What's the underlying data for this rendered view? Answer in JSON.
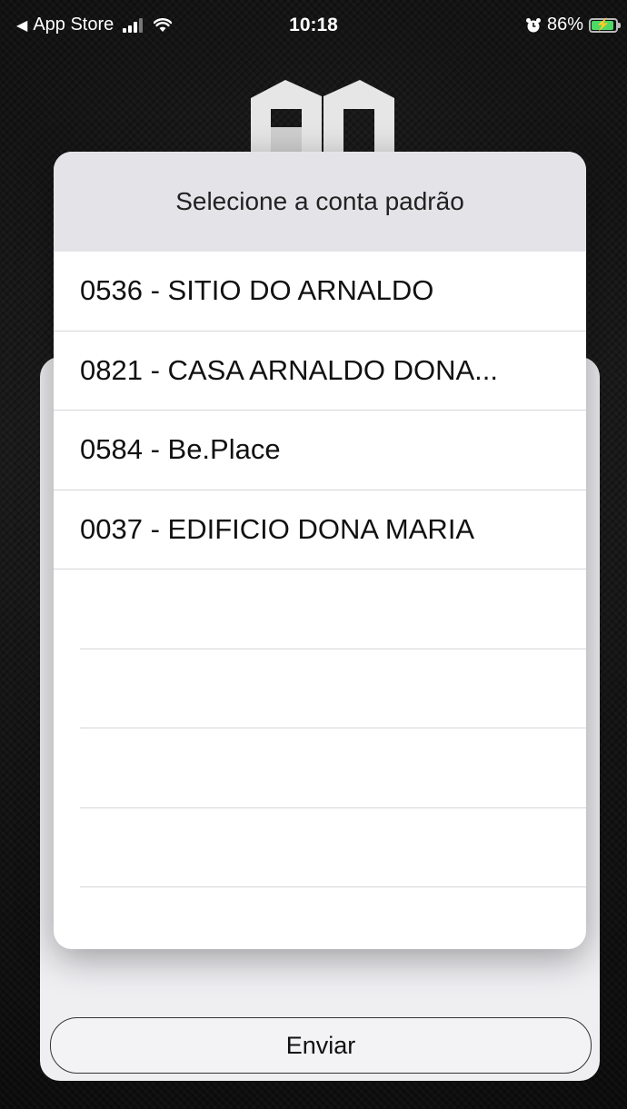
{
  "status_bar": {
    "back_label": "App Store",
    "time": "10:18",
    "battery_pct": "86%"
  },
  "dialog": {
    "title": "Selecione a conta padrão",
    "accounts": [
      "0536 - SITIO DO ARNALDO",
      "0821 - CASA ARNALDO DONA...",
      "0584 - Be.Place",
      "0037 - EDIFICIO DONA MARIA"
    ]
  },
  "footer": {
    "send_label": "Enviar"
  }
}
